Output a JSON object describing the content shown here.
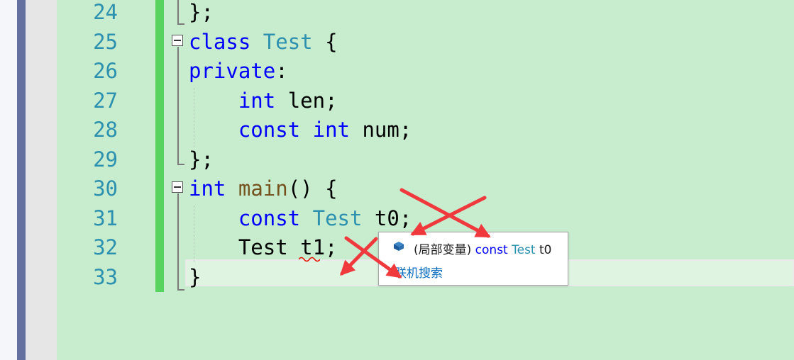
{
  "editor": {
    "lines": [
      {
        "num": "24",
        "segments": [
          {
            "t": "};",
            "c": "plain"
          }
        ]
      },
      {
        "num": "25",
        "segments": [
          {
            "t": "class",
            "c": "kw"
          },
          {
            "t": " ",
            "c": "plain"
          },
          {
            "t": "Test",
            "c": "typ"
          },
          {
            "t": " {",
            "c": "plain"
          }
        ]
      },
      {
        "num": "26",
        "segments": [
          {
            "t": "private",
            "c": "kw"
          },
          {
            "t": ":",
            "c": "plain"
          }
        ]
      },
      {
        "num": "27",
        "segments": [
          {
            "t": "    ",
            "c": "plain"
          },
          {
            "t": "int",
            "c": "kw"
          },
          {
            "t": " len;",
            "c": "plain"
          }
        ]
      },
      {
        "num": "28",
        "segments": [
          {
            "t": "    ",
            "c": "plain"
          },
          {
            "t": "const",
            "c": "kw"
          },
          {
            "t": " ",
            "c": "plain"
          },
          {
            "t": "int",
            "c": "kw"
          },
          {
            "t": " num;",
            "c": "plain"
          }
        ]
      },
      {
        "num": "29",
        "segments": [
          {
            "t": "};",
            "c": "plain"
          }
        ]
      },
      {
        "num": "30",
        "segments": [
          {
            "t": "int",
            "c": "kw"
          },
          {
            "t": " ",
            "c": "plain"
          },
          {
            "t": "main",
            "c": "fn"
          },
          {
            "t": "() {",
            "c": "plain"
          }
        ]
      },
      {
        "num": "31",
        "segments": [
          {
            "t": "    ",
            "c": "plain"
          },
          {
            "t": "const",
            "c": "kw"
          },
          {
            "t": " ",
            "c": "plain"
          },
          {
            "t": "Test",
            "c": "typ"
          },
          {
            "t": " t0;",
            "c": "plain"
          }
        ]
      },
      {
        "num": "32",
        "segments": [
          {
            "t": "    Test t1;",
            "c": "plain"
          }
        ]
      },
      {
        "num": "33",
        "segments": [
          {
            "t": "}",
            "c": "plain"
          }
        ]
      }
    ]
  },
  "quickinfo": {
    "icon": "local-variable-icon",
    "prefix": "(局部变量) ",
    "keyword": "const",
    "type_name": "Test",
    "variable": "t0",
    "link": "联机搜索"
  },
  "colors": {
    "background": "#c8ecce",
    "keyword": "#0000ff",
    "type": "#2b91af",
    "function": "#74531f",
    "line_number": "#2b91af",
    "change_bar": "#57d35f",
    "arrow": "#f0393c"
  }
}
